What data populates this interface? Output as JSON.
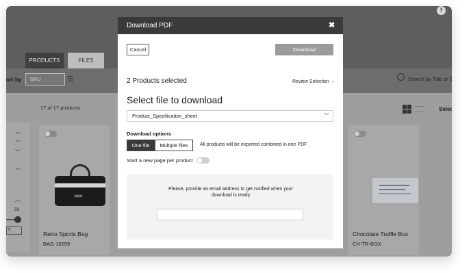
{
  "tabs": [
    {
      "label": "PRODUCTS"
    },
    {
      "label": "FILES"
    }
  ],
  "toolbar": {
    "sort_label": "ort by",
    "sort_value": "SKU",
    "search_placeholder": "Search by Title or S"
  },
  "listing": {
    "count_text": "17 of 17 products",
    "select_text": "Selec",
    "slider_value": "50",
    "mini_input_value": "0"
  },
  "cards": [
    {
      "name": "Retro Sports Bag",
      "sku": "BAG-10259",
      "logo_text": "plytix"
    },
    {
      "name": "Chocolate Truffle Box",
      "sku": "CH-TR-BOX"
    }
  ],
  "modal": {
    "title": "Download PDF",
    "close_symbol": "✖",
    "cancel_label": "Cancel",
    "download_label": "Download",
    "selected_text": "2 Products selected",
    "review_link": "Review Selection →",
    "section_title": "Select file to download",
    "file_select_value": "Product_Specification_sheet",
    "options_label": "Download options",
    "option_one": "One file",
    "option_multiple": "Multiple files",
    "options_description": "All products will be exported combined in one PDF",
    "new_page_label": "Start a new page per product",
    "new_page_toggle_on": false,
    "notify_text": "Please, provide an email address to get notified when your download is ready",
    "email_value": ""
  },
  "colors": {
    "modal_header": "#3a3a3a",
    "download_button": "#9b9b9b",
    "overlay_dark": "#5e5e5e"
  }
}
